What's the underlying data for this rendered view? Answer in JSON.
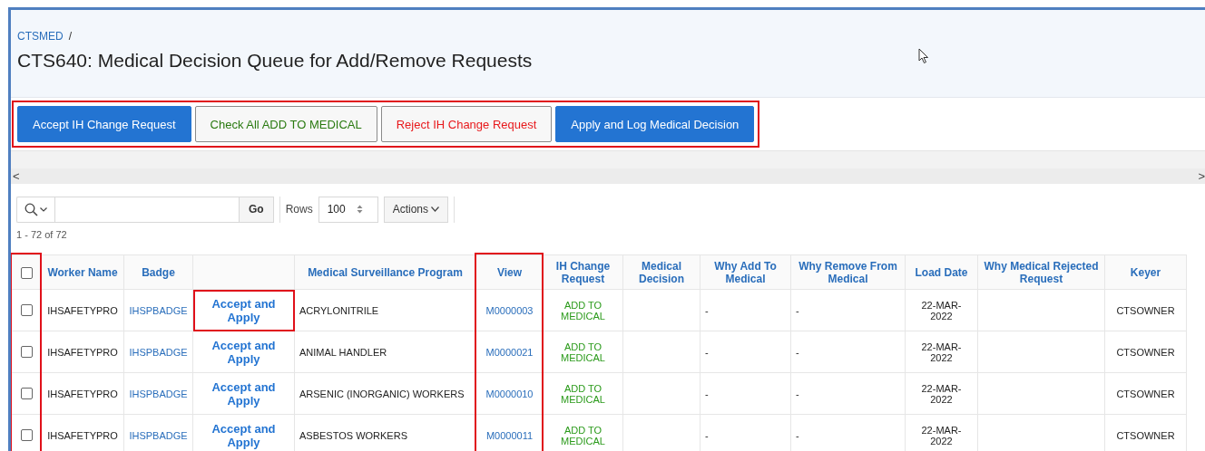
{
  "breadcrumb": {
    "items": [
      "CTSMED"
    ],
    "separator": "/"
  },
  "title": "CTS640: Medical Decision Queue for Add/Remove Requests",
  "buttons": [
    {
      "label": "Accept IH Change Request",
      "kind": "primary"
    },
    {
      "label": "Check All ADD TO MEDICAL",
      "kind": "success"
    },
    {
      "label": "Reject IH Change Request",
      "kind": "danger"
    },
    {
      "label": "Apply and Log Medical Decision",
      "kind": "primary"
    }
  ],
  "scroll": {
    "left": "<",
    "right": ">"
  },
  "toolbar": {
    "go": "Go",
    "rows_label": "Rows",
    "rows_value": "100",
    "actions": "Actions"
  },
  "pagination": "1 - 72 of 72",
  "table": {
    "columns": [
      {
        "kind": "checkbox",
        "checked": false,
        "highlighted": true
      },
      {
        "kind": "heading",
        "label": "Worker Name"
      },
      {
        "kind": "heading",
        "label": "Badge"
      },
      {
        "kind": "blank"
      },
      {
        "kind": "heading",
        "label": "Medical Surveillance Program"
      },
      {
        "kind": "heading",
        "label": "View",
        "highlighted": true
      },
      {
        "kind": "heading",
        "label": "IH Change Request"
      },
      {
        "kind": "heading",
        "label": "Medical Decision"
      },
      {
        "kind": "heading",
        "label": "Why Add To Medical"
      },
      {
        "kind": "heading",
        "label": "Why Remove From Medical"
      },
      {
        "kind": "heading",
        "label": "Load Date"
      },
      {
        "kind": "heading",
        "label": "Why Medical Rejected Request"
      },
      {
        "kind": "heading",
        "label": "Keyer"
      }
    ],
    "rows": [
      {
        "cells": [
          {
            "kind": "checkbox",
            "checked": false
          },
          {
            "kind": "text",
            "text": "IHSAFETYPRO"
          },
          {
            "kind": "link",
            "text": "IHSPBADGE"
          },
          {
            "kind": "action",
            "text": "Accept and Apply",
            "highlighted": true
          },
          {
            "kind": "name",
            "text": "ACRYLONITRILE"
          },
          {
            "kind": "link",
            "text": "M0000003"
          },
          {
            "kind": "status",
            "text": "ADD TO MEDICAL"
          },
          {
            "kind": "empty"
          },
          {
            "kind": "note",
            "text": "-"
          },
          {
            "kind": "note",
            "text": "-"
          },
          {
            "kind": "date",
            "text": "22-MAR-2022"
          },
          {
            "kind": "empty"
          },
          {
            "kind": "text",
            "text": "CTSOWNER"
          }
        ]
      },
      {
        "cells": [
          {
            "kind": "checkbox",
            "checked": false
          },
          {
            "kind": "text",
            "text": "IHSAFETYPRO"
          },
          {
            "kind": "link",
            "text": "IHSPBADGE"
          },
          {
            "kind": "action",
            "text": "Accept and Apply"
          },
          {
            "kind": "name",
            "text": "ANIMAL HANDLER"
          },
          {
            "kind": "link",
            "text": "M0000021"
          },
          {
            "kind": "status",
            "text": "ADD TO MEDICAL"
          },
          {
            "kind": "empty"
          },
          {
            "kind": "note",
            "text": "-"
          },
          {
            "kind": "note",
            "text": "-"
          },
          {
            "kind": "date",
            "text": "22-MAR-2022"
          },
          {
            "kind": "empty"
          },
          {
            "kind": "text",
            "text": "CTSOWNER"
          }
        ]
      },
      {
        "cells": [
          {
            "kind": "checkbox",
            "checked": false
          },
          {
            "kind": "text",
            "text": "IHSAFETYPRO"
          },
          {
            "kind": "link",
            "text": "IHSPBADGE"
          },
          {
            "kind": "action",
            "text": "Accept and Apply"
          },
          {
            "kind": "name",
            "text": "ARSENIC (INORGANIC) WORKERS"
          },
          {
            "kind": "link",
            "text": "M0000010"
          },
          {
            "kind": "status",
            "text": "ADD TO MEDICAL"
          },
          {
            "kind": "empty"
          },
          {
            "kind": "note",
            "text": "-"
          },
          {
            "kind": "note",
            "text": "-"
          },
          {
            "kind": "date",
            "text": "22-MAR-2022"
          },
          {
            "kind": "empty"
          },
          {
            "kind": "text",
            "text": "CTSOWNER"
          }
        ]
      },
      {
        "cells": [
          {
            "kind": "checkbox",
            "checked": false
          },
          {
            "kind": "text",
            "text": "IHSAFETYPRO"
          },
          {
            "kind": "link",
            "text": "IHSPBADGE"
          },
          {
            "kind": "action",
            "text": "Accept and Apply"
          },
          {
            "kind": "name",
            "text": "ASBESTOS WORKERS"
          },
          {
            "kind": "link",
            "text": "M0000011"
          },
          {
            "kind": "status",
            "text": "ADD TO MEDICAL"
          },
          {
            "kind": "empty"
          },
          {
            "kind": "note",
            "text": "-"
          },
          {
            "kind": "note",
            "text": "-"
          },
          {
            "kind": "date",
            "text": "22-MAR-2022"
          },
          {
            "kind": "empty"
          },
          {
            "kind": "text",
            "text": "CTSOWNER"
          }
        ]
      }
    ]
  }
}
